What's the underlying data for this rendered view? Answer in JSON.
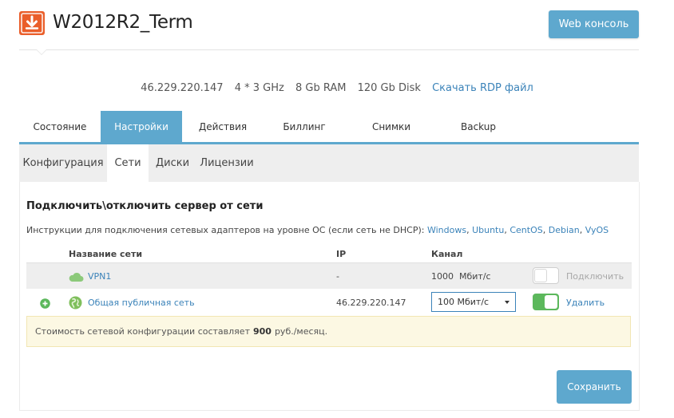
{
  "header": {
    "title": "W2012R2_Term",
    "web_console_label": "Web консоль",
    "icon": "download-icon",
    "accent_color": "#ea5e2a"
  },
  "specs": {
    "ip": "46.229.220.147",
    "cpu": "4 * 3 GHz",
    "ram": "8 Gb RAM",
    "disk": "120 Gb Disk",
    "rdp_link": "Скачать RDP файл"
  },
  "main_tabs": [
    {
      "label": "Состояние",
      "active": false
    },
    {
      "label": "Настройки",
      "active": true
    },
    {
      "label": "Действия",
      "active": false
    },
    {
      "label": "Биллинг",
      "active": false
    },
    {
      "label": "Снимки",
      "active": false
    },
    {
      "label": "Backup",
      "active": false
    }
  ],
  "sub_tabs": [
    {
      "label": "Конфигурация",
      "active": false
    },
    {
      "label": "Сети",
      "active": true
    },
    {
      "label": "Диски",
      "active": false
    },
    {
      "label": "Лицензии",
      "active": false
    }
  ],
  "network": {
    "section_title": "Подключить\\отключить сервер от сети",
    "instructions_text": "Инструкции для подключения сетевых адаптеров на уровне ОС (если сеть не DHCP):",
    "os_links": [
      "Windows",
      "Ubuntu",
      "CentOS",
      "Debian",
      "VyOS"
    ],
    "columns": {
      "name": "Название сети",
      "ip": "IP",
      "channel": "Канал"
    },
    "rows": [
      {
        "name": "VPN1",
        "icon": "cloud-icon",
        "ip": "-",
        "channel": "1000  Мбит/с",
        "toggle_on": false,
        "action": "Подключить"
      },
      {
        "name": "Общая публичная сеть",
        "icon": "globe-icon",
        "ip": "46.229.220.147",
        "channel": "100 Мбит/с",
        "toggle_on": true,
        "action": "Удалить"
      }
    ],
    "notice_prefix": "Стоимость сетевой конфигурации составляет",
    "notice_amount": "900",
    "notice_suffix": "руб./месяц.",
    "save_label": "Сохранить"
  },
  "colors": {
    "primary": "#5ea8ce",
    "link": "#3b83b9",
    "success": "#5cb85c",
    "cloud": "#8cc97a"
  }
}
